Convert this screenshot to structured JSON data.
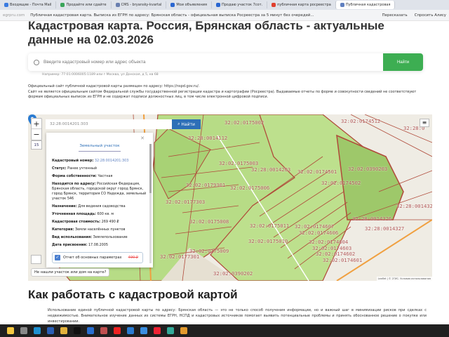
{
  "browser": {
    "tabs": [
      {
        "label": "Входящие - Почта Mail",
        "color": "#3b7be0"
      },
      {
        "label": "Продайте или сдайте",
        "color": "#3aa55a"
      },
      {
        "label": "CMS - bryansky-kvartal",
        "color": "#6a7fb0"
      },
      {
        "label": "Мои объявления",
        "color": "#2b67d1"
      },
      {
        "label": "Продаю участок 7сот.",
        "color": "#2b67d1"
      },
      {
        "label": "публичная карта росреестра",
        "color": "#e0402f"
      },
      {
        "label": "Публичная кадастровая",
        "color": "#6080c0",
        "active": true
      }
    ],
    "domain": "egrpru.com",
    "page_title": "Публичная кадастровая карта. Выписка из ЕГРН по адресу: Брянская область - официальная выписка Росреестра за 5 минут без очередей...",
    "retell": "Пересказать",
    "ask_alice": "Спросить Алису"
  },
  "page": {
    "title": "Кадастровая карта. Россия, Брянская область - актуальные данные на 02.03.2026",
    "search": {
      "placeholder": "Введите кадастровый номер или адрес объекта",
      "button": "Найти",
      "hint": "Например: 77:01:0006005:1189 или г Москва, ул Донская, д 5, кв 68"
    },
    "notice": [
      "Официальный сайт публичной кадастровой карты размещен по адресу: https://nspd.gov.ru/.",
      "Сайт не является официальным сайтом Федеральной службы государственной регистрации кадастра и картографии (Росреестра). Выдаваемые отчеты по форме и совокупности сведений не соответствуют формам официальных выписок из ЕГРН и не содержат подписи должностных лиц, в том числе электронной цифровой подписи."
    ],
    "h2": "Как работать с кадастровой картой",
    "para": "Использование единой публичной кадастровой карты по адресу: Брянская область — это не только способ получения информации, но и важный шаг в минимизации рисков при сделках с недвижимостью. Внимательное изучение данных из системы ЕГРН, НСПД и кадастровых источников помогает выявить потенциальные проблемы и принять обоснованное решение о покупке или инвестировании."
  },
  "map": {
    "search_value": "32:28:0014201:303",
    "find": "Найти",
    "zoom_in": "+",
    "zoom_out": "−",
    "zoom_level": "15",
    "not_found": "Не нашли участок или дом на карте?",
    "attribution": "Leaflet | © 2ГИС. Условия использования",
    "popup": {
      "title": "Земельный участок",
      "rows": [
        {
          "k": "Кадастровый номер:",
          "v": "32:28:0014201:303"
        },
        {
          "k": "Статус:",
          "v": "Ранее учтенный"
        },
        {
          "k": "Форма собственности:",
          "v": "Частная"
        },
        {
          "k": "Находится по адресу:",
          "v": "Российская Федерация, Брянская область, городской округ город Брянск, город Брянск, территория СО Надежда, земельный участок 546"
        },
        {
          "k": "Назначение:",
          "v": "Для ведения садоводства"
        },
        {
          "k": "Уточненная площадь:",
          "v": "600 кв. м"
        },
        {
          "k": "Кадастровая стоимость:",
          "v": "269 490 ₽"
        },
        {
          "k": "Категория:",
          "v": "Земли населённых пунктов"
        },
        {
          "k": "Вид использования:",
          "v": "Землепользование"
        },
        {
          "k": "Дата присвоения:",
          "v": "17.08.2005"
        }
      ],
      "report": "Отчет об основных параметрах",
      "report_price": "490 ₽"
    },
    "labels": [
      "32:02:0175002",
      "32:28:0014112",
      "32:02:0174512",
      "32:28:0",
      "32:02:0175003",
      "32:28:0014203",
      "32:02:0174501",
      "32:02:0390203",
      "32:02:0174502",
      "32:02:0179301",
      "32:02:0175006",
      "32:02:0177303",
      "32:28:001432",
      "32:28:0014326",
      "32:28:0014327",
      "32:02:0175008",
      "32:02:0175011",
      "32:02:0174607",
      "32:02:0174606",
      "32:02:0175010",
      "32:02:0174604",
      "32:02:0174603",
      "32:02:0174602",
      "32:02:0174601",
      "32:02:0175009",
      "32:02:0177301",
      "32:02:0390202"
    ]
  }
}
